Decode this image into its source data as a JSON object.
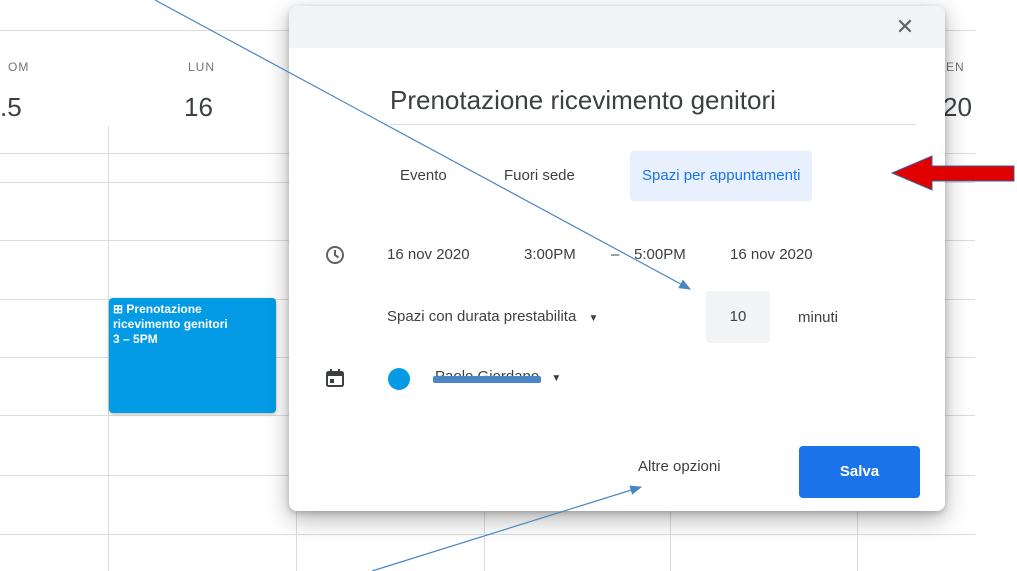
{
  "calendar": {
    "days": [
      {
        "name": "OM",
        "number": ".5"
      },
      {
        "name": "LUN",
        "number": "16"
      },
      {
        "name": "EN",
        "number": "20"
      }
    ],
    "event": {
      "title_line1": "⊞ Prenotazione",
      "title_line2": "ricevimento genitori",
      "time": "3 – 5PM",
      "color": "#039be5"
    }
  },
  "dialog": {
    "close_icon": "close-icon",
    "title": "Prenotazione ricevimento genitori",
    "tabs": [
      {
        "label": "Evento",
        "active": false
      },
      {
        "label": "Fuori sede",
        "active": false
      },
      {
        "label": "Spazi per appuntamenti",
        "active": true
      }
    ],
    "datetime": {
      "start_date": "16 nov 2020",
      "start_time": "3:00PM",
      "dash": "–",
      "end_time": "5:00PM",
      "end_date": "16 nov 2020"
    },
    "slots": {
      "label": "Spazi con durata prestabilita",
      "value": "10",
      "unit": "minuti"
    },
    "calendar_owner": {
      "name": "Paolo Giordano",
      "dot_color": "#039be5"
    },
    "more_options": "Altre opzioni",
    "save": "Salva"
  },
  "accent": "#1a73e8",
  "annotation_arrow_color": "#e00000"
}
